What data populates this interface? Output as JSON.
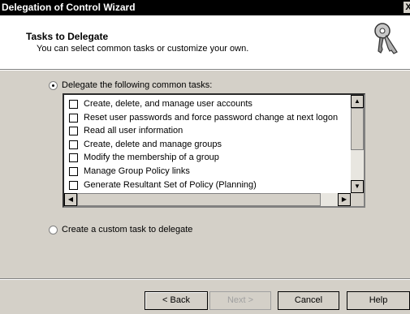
{
  "window": {
    "title": "Delegation of Control Wizard",
    "close_glyph": "X"
  },
  "header": {
    "title": "Tasks to Delegate",
    "subtitle": "You can select common tasks or customize your own.",
    "icon": "keys-icon"
  },
  "options": {
    "common": {
      "label": "Delegate the following common tasks:",
      "selected": true
    },
    "custom": {
      "label": "Create a custom task to delegate",
      "selected": false
    }
  },
  "tasks": [
    {
      "label": "Create, delete, and manage user accounts",
      "checked": false
    },
    {
      "label": "Reset user passwords and force password change at next logon",
      "checked": false
    },
    {
      "label": "Read all user information",
      "checked": false
    },
    {
      "label": "Create, delete and manage groups",
      "checked": false
    },
    {
      "label": "Modify the membership of a group",
      "checked": false
    },
    {
      "label": "Manage Group Policy links",
      "checked": false
    },
    {
      "label": "Generate Resultant Set of Policy (Planning)",
      "checked": false
    }
  ],
  "buttons": {
    "back": "< Back",
    "next": "Next >",
    "cancel": "Cancel",
    "help": "Help"
  }
}
